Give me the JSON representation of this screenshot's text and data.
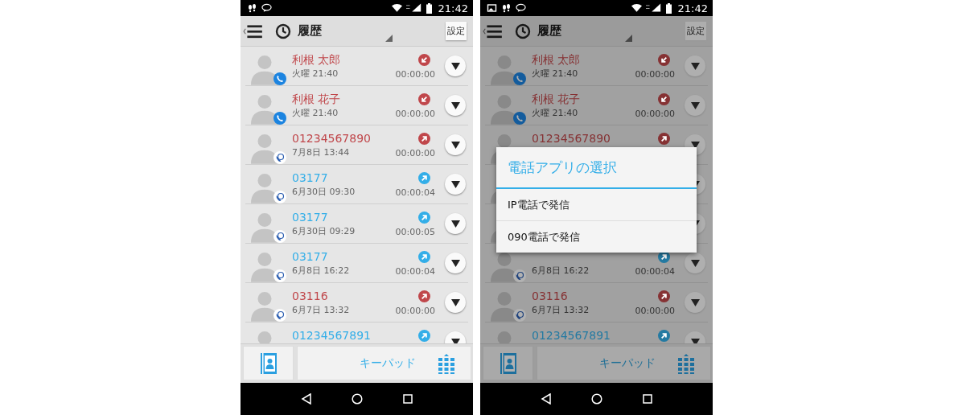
{
  "screens": [
    {
      "status_bar": {
        "icons": [
          {
            "kind": "footprints"
          },
          {
            "kind": "chat"
          }
        ],
        "time": "21:42"
      },
      "app_bar": {
        "title": "履歴",
        "settings": "設定"
      },
      "rows": [
        {
          "name": "利根 太郎",
          "date": "火曜 21:40",
          "duration": "00:00:00",
          "kind": "in",
          "color": "#c0474b",
          "badge": {
            "kind": "phone"
          }
        },
        {
          "name": "利根 花子",
          "date": "火曜 21:40",
          "duration": "00:00:00",
          "kind": "in",
          "color": "#c0474b",
          "badge": {
            "kind": "phone"
          }
        },
        {
          "name": "01234567890",
          "date": "7月8日 13:44",
          "duration": "00:00:00",
          "kind": "out",
          "color": "#c0474b",
          "badge": {
            "kind": "ip"
          }
        },
        {
          "name": "03177",
          "date": "6月30日 09:30",
          "duration": "00:00:04",
          "kind": "out",
          "color": "#33aee8",
          "badge": {
            "kind": "ip"
          }
        },
        {
          "name": "03177",
          "date": "6月30日 09:29",
          "duration": "00:00:05",
          "kind": "out",
          "color": "#33aee8",
          "badge": {
            "kind": "ip"
          }
        },
        {
          "name": "03177",
          "date": "6月8日 16:22",
          "duration": "00:00:04",
          "kind": "out",
          "color": "#33aee8",
          "badge": {
            "kind": "ip"
          }
        },
        {
          "name": "03116",
          "date": "6月7日 13:32",
          "duration": "00:00:00",
          "kind": "out",
          "color": "#c0474b",
          "badge": {
            "kind": "ip"
          }
        },
        {
          "name": "01234567891",
          "kind": "out",
          "color": "#33aee8"
        }
      ],
      "bottom_bar": {
        "keypad": "キーパッド"
      }
    },
    {
      "status_bar": {
        "icons": [
          {
            "kind": "image"
          },
          {
            "kind": "footprints"
          },
          {
            "kind": "chat"
          }
        ],
        "time": "21:42"
      },
      "app_bar": {
        "title": "履歴",
        "settings": "設定"
      },
      "rows": [
        {
          "name": "利根 太郎",
          "date": "火曜 21:40",
          "duration": "00:00:00",
          "kind": "in",
          "color": "#863234",
          "badge": {
            "kind": "phone"
          }
        },
        {
          "name": "利根 花子",
          "date": "火曜 21:40",
          "duration": "00:00:00",
          "kind": "in",
          "color": "#863234",
          "badge": {
            "kind": "phone"
          }
        },
        {
          "name": "01234567890",
          "kind": "out",
          "color": "#863234"
        },
        {},
        {},
        {
          "date": "6月8日 16:22",
          "duration": "00:00:04",
          "kind": "out",
          "color": "#247aa2",
          "badge": {
            "kind": "ip"
          }
        },
        {
          "name": "03116",
          "date": "6月7日 13:32",
          "duration": "00:00:00",
          "kind": "out",
          "color": "#863234",
          "badge": {
            "kind": "ip"
          }
        },
        {
          "name": "01234567891",
          "kind": "out",
          "color": "#247aa2"
        }
      ],
      "bottom_bar": {
        "keypad": "キーパッド"
      },
      "dialog": {
        "title": "電話アプリの選択",
        "options": [
          "IP電話で発信",
          "090電話で発信"
        ]
      }
    }
  ]
}
